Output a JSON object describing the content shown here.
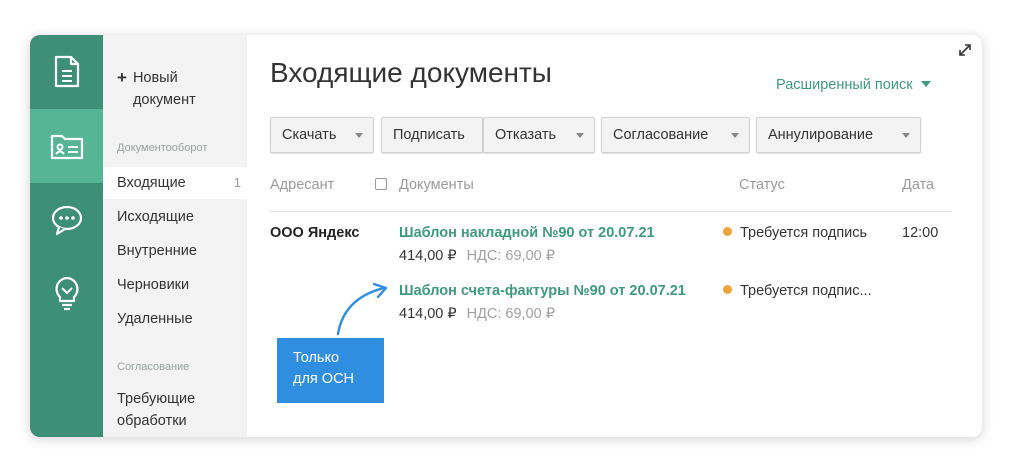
{
  "rail": {
    "items": [
      {
        "icon": "document-icon"
      },
      {
        "icon": "folder-card-icon",
        "active": true
      },
      {
        "icon": "chat-icon"
      },
      {
        "icon": "lightbulb-icon"
      }
    ]
  },
  "sidebar": {
    "new_document": "Новый документ",
    "section_docflow": "Документооборот",
    "folders": [
      {
        "label": "Входящие",
        "count": "1"
      },
      {
        "label": "Исходящие"
      },
      {
        "label": "Внутренние"
      },
      {
        "label": "Черновики"
      },
      {
        "label": "Удаленные"
      }
    ],
    "section_approval": "Согласование",
    "needs_processing": "Требующие обработки"
  },
  "main": {
    "title": "Входящие документы",
    "advanced_search": "Расширенный поиск",
    "toolbar": {
      "download": "Скачать",
      "sign": "Подписать",
      "reject": "Отказать",
      "approval": "Согласование",
      "annulment": "Аннулирование"
    },
    "columns": {
      "sender": "Адресант",
      "documents": "Документы",
      "status": "Статус",
      "date": "Дата"
    },
    "rows": [
      {
        "sender": "ООО Яндекс",
        "date": "12:00",
        "documents": [
          {
            "title": "Шаблон накладной №90 от 20.07.21",
            "amount": "414,00 ₽",
            "vat": "НДС: 69,00 ₽",
            "status": "Требуется подпись"
          },
          {
            "title": "Шаблон счета-фактуры №90 от 20.07.21",
            "amount": "414,00 ₽",
            "vat": "НДС: 69,00 ₽",
            "status": "Требуется подпис..."
          }
        ]
      }
    ],
    "status_color": "#f0a43a"
  },
  "callout": {
    "line1": "Только",
    "line2": "для ОСН"
  },
  "colors": {
    "rail": "#3d8f76",
    "rail_active": "#55b595",
    "accent": "#3d9a7a",
    "callout": "#2f8ee0"
  }
}
